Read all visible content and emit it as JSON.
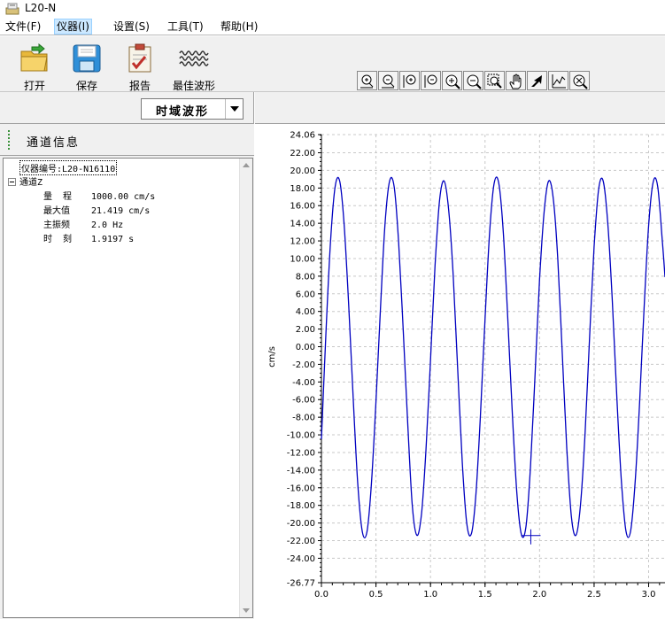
{
  "window": {
    "title": "L20-N",
    "icon": "instrument-app-icon"
  },
  "menu": [
    {
      "label": "文件(F)",
      "active": false
    },
    {
      "label": "仪器(I)",
      "active": true
    },
    {
      "label": "设置(S)",
      "active": false
    },
    {
      "label": "工具(T)",
      "active": false
    },
    {
      "label": "帮助(H)",
      "active": false
    }
  ],
  "toolbar": {
    "open_label": "打开",
    "save_label": "保存",
    "report_label": "报告",
    "best_wave_label": "最佳波形"
  },
  "zoom_tools": [
    "zoom-in-x-icon",
    "zoom-out-x-icon",
    "zoom-in-y-icon",
    "zoom-out-y-icon",
    "zoom-in-icon",
    "zoom-out-icon",
    "zoom-region-icon",
    "pan-hand-icon",
    "undo-arrow-icon",
    "auto-fit-icon",
    "reset-zoom-icon"
  ],
  "view_select": {
    "value": "时域波形"
  },
  "channel_panel": {
    "title": "通道信息",
    "instrument_id": "仪器编号:L20-N16110",
    "channel_name": "通道Z",
    "rows": [
      {
        "label": "量  程",
        "value": "1000.00 cm/s"
      },
      {
        "label": "最大值",
        "value": "21.419 cm/s"
      },
      {
        "label": "主振频",
        "value": "2.0 Hz"
      },
      {
        "label": "时  刻",
        "value": "1.9197 s"
      }
    ]
  },
  "colors": {
    "trace": "#0000c0",
    "grid": "#c8c8c8",
    "marker": "#0000c0"
  },
  "chart_data": {
    "type": "line",
    "title": "",
    "xlabel": "",
    "ylabel": "cm/s",
    "xlim": [
      0.0,
      3.15
    ],
    "ylim": [
      -26.77,
      24.06
    ],
    "x_ticks": [
      "0.0",
      "0.5",
      "1.0",
      "1.5",
      "2.0",
      "2.5",
      "3.0"
    ],
    "y_ticks": [
      "24.06",
      "22.00",
      "20.00",
      "18.00",
      "16.00",
      "14.00",
      "12.00",
      "10.00",
      "8.00",
      "6.00",
      "4.00",
      "2.00",
      "0.00",
      "-2.00",
      "-4.00",
      "-6.00",
      "-8.00",
      "-10.00",
      "-12.00",
      "-14.00",
      "-16.00",
      "-18.00",
      "-20.00",
      "-22.00",
      "-24.00",
      "-26.77"
    ],
    "grid": true,
    "series": [
      {
        "x": [
          0.0,
          0.042,
          0.083,
          0.125,
          0.167,
          0.208,
          0.25,
          0.292,
          0.333,
          0.375,
          0.417,
          0.458,
          0.5,
          0.542,
          0.583,
          0.625,
          0.667,
          0.708,
          0.75,
          0.792,
          0.833,
          0.875,
          0.917,
          0.958,
          1.0,
          1.042,
          1.083,
          1.125,
          1.167,
          1.208,
          1.25,
          1.292,
          1.333,
          1.375,
          1.417,
          1.458,
          1.5,
          1.542,
          1.583,
          1.625,
          1.667,
          1.708,
          1.75,
          1.792,
          1.833,
          1.875,
          1.917,
          1.958,
          2.0,
          2.042,
          2.083,
          2.125,
          2.167,
          2.208,
          2.25,
          2.292,
          2.333,
          2.375,
          2.417,
          2.458,
          2.5,
          2.542,
          2.583,
          2.625,
          2.667,
          2.708,
          2.75,
          2.792,
          2.833,
          2.875,
          2.917,
          2.958,
          3.0,
          3.042,
          3.083,
          3.125,
          3.15
        ],
        "y": [
          -10.5,
          1.8,
          11.8,
          18.1,
          18.8,
          13.9,
          4.7,
          -6.1,
          -15.5,
          -21.0,
          -21.0,
          -15.6,
          -6.2,
          4.6,
          13.9,
          18.8,
          18.1,
          11.8,
          1.8,
          -9.0,
          -18.0,
          -21.4,
          -19.0,
          -11.8,
          -1.5,
          9.2,
          16.6,
          18.8,
          15.5,
          8.1,
          -2.8,
          -13.2,
          -20.1,
          -21.2,
          -16.7,
          -7.7,
          3.2,
          12.9,
          18.5,
          18.6,
          13.1,
          3.3,
          -7.6,
          -16.6,
          -21.3,
          -20.4,
          -13.6,
          -3.3,
          7.6,
          15.3,
          18.8,
          16.9,
          10.0,
          -0.8,
          -11.6,
          -19.3,
          -21.4,
          -18.0,
          -9.9,
          1.0,
          11.3,
          17.9,
          18.8,
          14.1,
          5.2,
          -5.7,
          -15.2,
          -20.9,
          -21.0,
          -15.6,
          -6.4,
          4.4,
          13.7,
          18.7,
          18.2,
          12.1,
          7.9
        ]
      }
    ],
    "marker": {
      "x": 1.9197,
      "y": -21.419
    }
  }
}
